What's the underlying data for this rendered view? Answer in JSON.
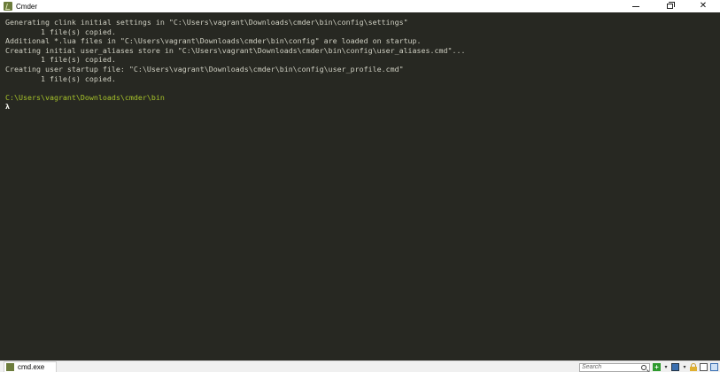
{
  "window": {
    "title": "Cmder",
    "minimize_label": "minimize",
    "maximize_label": "restore",
    "close_glyph": "✕"
  },
  "console": {
    "lines": [
      "Generating clink initial settings in \"C:\\Users\\vagrant\\Downloads\\cmder\\bin\\config\\settings\"",
      "        1 file(s) copied.",
      "Additional *.lua files in \"C:\\Users\\vagrant\\Downloads\\cmder\\bin\\config\" are loaded on startup.",
      "Creating initial user_aliases store in \"C:\\Users\\vagrant\\Downloads\\cmder\\bin\\config\\user_aliases.cmd\"...",
      "        1 file(s) copied.",
      "Creating user startup file: \"C:\\Users\\vagrant\\Downloads\\cmder\\bin\\config\\user_profile.cmd\"",
      "        1 file(s) copied."
    ],
    "current_path": "C:\\Users\\vagrant\\Downloads\\cmder\\bin",
    "prompt": "λ",
    "colors": {
      "background": "#272822",
      "text": "#cfcfc2",
      "path": "#a6c22a",
      "prompt": "#f8f8f2"
    }
  },
  "statusbar": {
    "tab_label": "cmd.exe",
    "search_placeholder": "Search",
    "add_tab_glyph": "+",
    "dropdown_glyph": "▾",
    "icons": [
      "plus-icon",
      "dropdown-icon",
      "grid-icon",
      "dropdown-icon",
      "lock-icon",
      "pane-icon",
      "pane-icon"
    ]
  }
}
